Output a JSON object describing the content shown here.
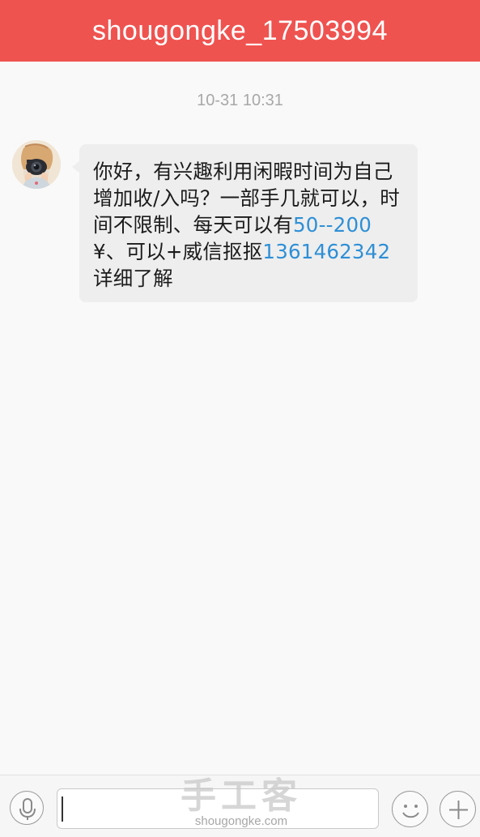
{
  "header": {
    "title": "shougongke_17503994"
  },
  "colors": {
    "header_bg": "#ef5350",
    "link": "#2e8fd6",
    "bubble_bg": "#eeeeee"
  },
  "conversation": {
    "timestamp": "10-31 10:31",
    "messages": [
      {
        "sender": "other",
        "avatar_icon": "avatar-photo-icon",
        "parts": [
          {
            "text": "你好，有兴趣利用闲暇时间为自己增加收/入吗？一部手几就可以，时间不限制、每天可以有",
            "link": false
          },
          {
            "text": "50--200",
            "link": true
          },
          {
            "text": "¥、可以+威信抠抠",
            "link": false
          },
          {
            "text": "1361462342",
            "link": true
          },
          {
            "text": "详细了解",
            "link": false
          }
        ]
      }
    ]
  },
  "input_bar": {
    "voice_icon": "microphone-icon",
    "text_value": "",
    "emoji_icon": "smiley-icon",
    "more_icon": "plus-icon"
  },
  "watermark": {
    "line1": "手工客",
    "line2": "shougongke.com"
  }
}
